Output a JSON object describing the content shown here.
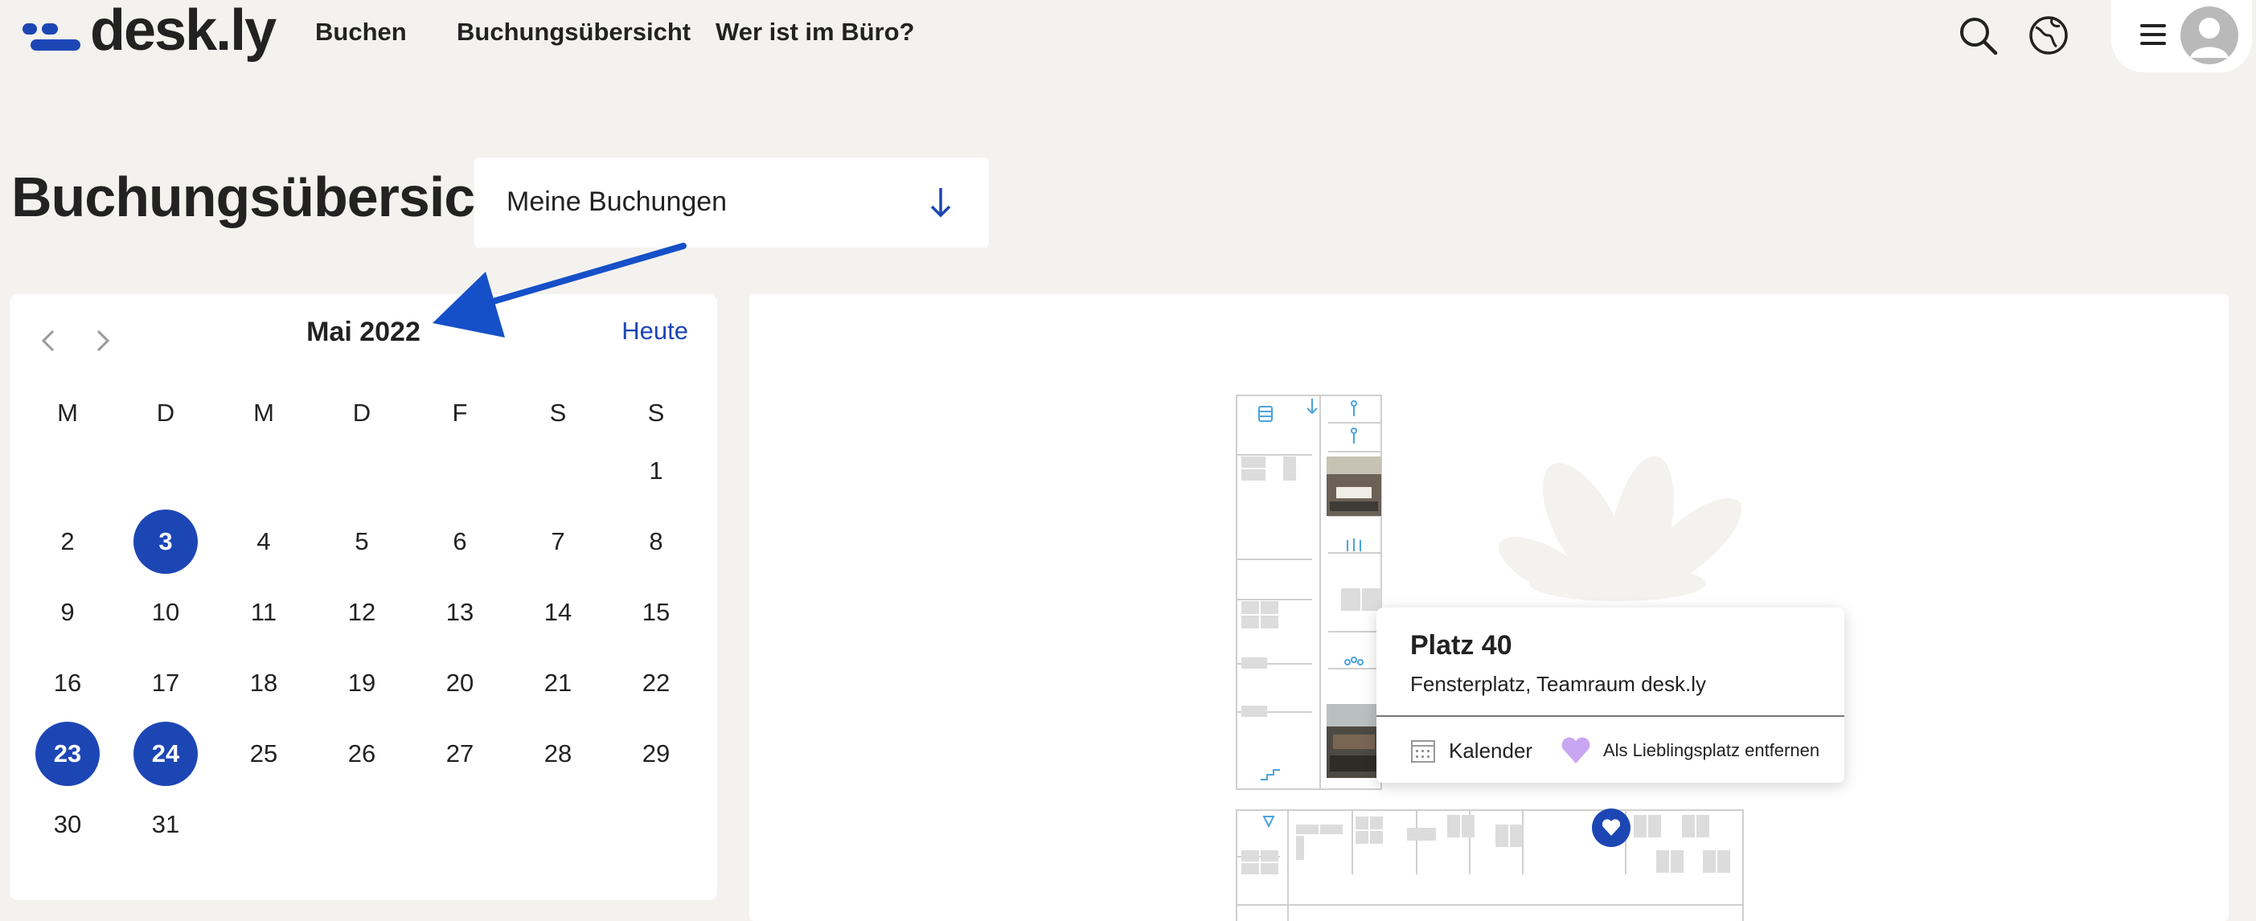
{
  "header": {
    "logo_text": "desk.ly",
    "nav": [
      "Buchen",
      "Buchungsübersicht",
      "Wer ist im Büro?"
    ],
    "icons": [
      "search-icon",
      "globe-icon",
      "menu-icon",
      "avatar-icon"
    ]
  },
  "page": {
    "title": "Buchungsübersicht",
    "filter_value": "Meine Buchungen"
  },
  "calendar": {
    "month_label": "Mai 2022",
    "today_label": "Heute",
    "weekdays": [
      "M",
      "D",
      "M",
      "D",
      "F",
      "S",
      "S"
    ],
    "days": [
      "1",
      "2",
      "3",
      "4",
      "5",
      "6",
      "7",
      "8",
      "9",
      "10",
      "11",
      "12",
      "13",
      "14",
      "15",
      "16",
      "17",
      "18",
      "19",
      "20",
      "21",
      "22",
      "23",
      "24",
      "25",
      "26",
      "27",
      "28",
      "29",
      "30",
      "31"
    ],
    "selected_days": [
      "3",
      "23",
      "24"
    ]
  },
  "popup": {
    "title": "Platz 40",
    "subtitle": "Fensterplatz, Teamraum desk.ly",
    "calendar_action": "Kalender",
    "favorite_action": "Als Lieblingsplatz entfernen"
  },
  "colors": {
    "accent": "#1d46b5",
    "background": "#f3f2ef",
    "map_line": "#cfcfcf",
    "room_icon": "#4aa3df",
    "heart": "#c9a6f2"
  }
}
